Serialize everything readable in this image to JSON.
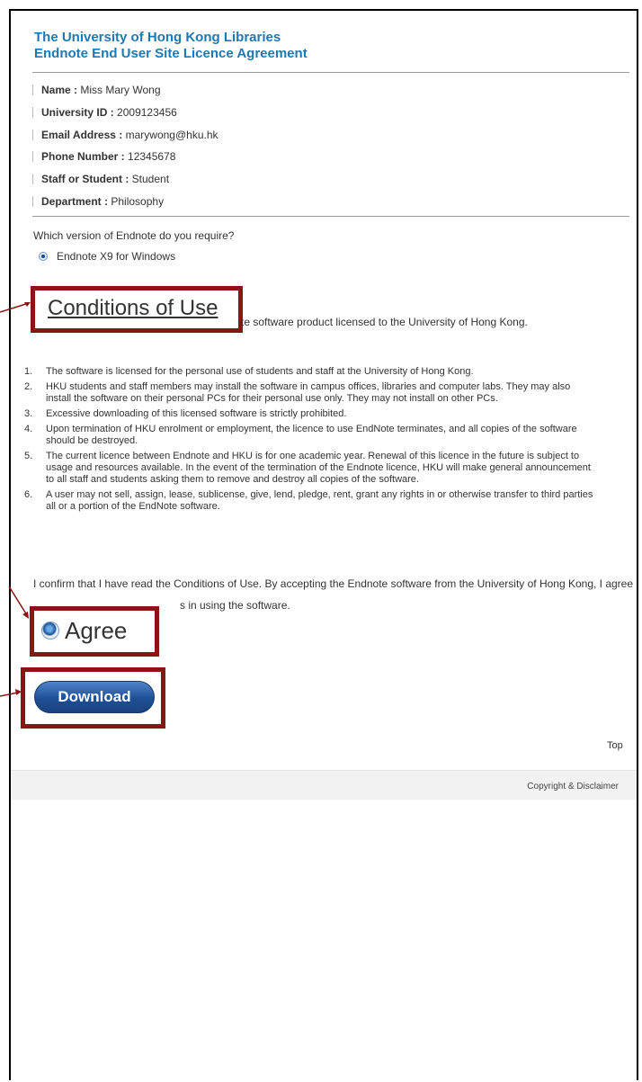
{
  "header": {
    "title_line1": "The University of Hong Kong Libraries",
    "title_line2": "Endnote End User Site Licence Agreement"
  },
  "user_info": [
    {
      "label": "Name :",
      "value": "Miss Mary Wong"
    },
    {
      "label": "University ID :",
      "value": "2009123456"
    },
    {
      "label": "Email Address :",
      "value": "marywong@hku.hk"
    },
    {
      "label": "Phone Number :",
      "value": "12345678"
    },
    {
      "label": "Staff or Student :",
      "value": "Student"
    },
    {
      "label": "Department :",
      "value": "Philosophy"
    }
  ],
  "version": {
    "question": "Which version of Endnote do you require?",
    "selected_option": "Endnote X9 for Windows"
  },
  "conditions": {
    "title": "Conditions of Use",
    "intro_tail": "te software product licensed to the University of Hong Kong.",
    "terms": [
      "The software is licensed for the personal use of students and staff at the University of Hong Kong.",
      "HKU students and staff members may install the software in campus offices, libraries and computer labs. They may also install the software on their personal PCs for their personal use only. They may not install on other PCs.",
      "Excessive downloading of this licensed software is strictly prohibited.",
      "Upon termination of HKU enrolment or employment, the licence to use EndNote terminates, and all copies of the software should be destroyed.",
      "The current licence between Endnote and HKU is for one academic year. Renewal of this licence in the future is subject to usage and resources available. In the event of the termination of the Endnote licence, HKU will make general announcement to all staff and students asking them to remove and destroy all copies of the software.",
      "A user may not sell, assign, lease, sublicense, give, lend, pledge, rent, grant any rights in or otherwise transfer to third parties all or a portion of the EndNote software."
    ]
  },
  "confirmation": {
    "line1": "I confirm that I have read the Conditions of Use. By accepting the Endnote software from the University of Hong Kong, I agree",
    "line2_tail": "s in using the software.",
    "agree_label": "Agree"
  },
  "actions": {
    "download_label": "Download",
    "top_link": "Top"
  },
  "footer": {
    "text": "Copyright & Disclaimer"
  },
  "colors": {
    "title_blue": "#1f78b0",
    "highlight_red": "#8b1414",
    "button_blue": "#1e4f96"
  }
}
